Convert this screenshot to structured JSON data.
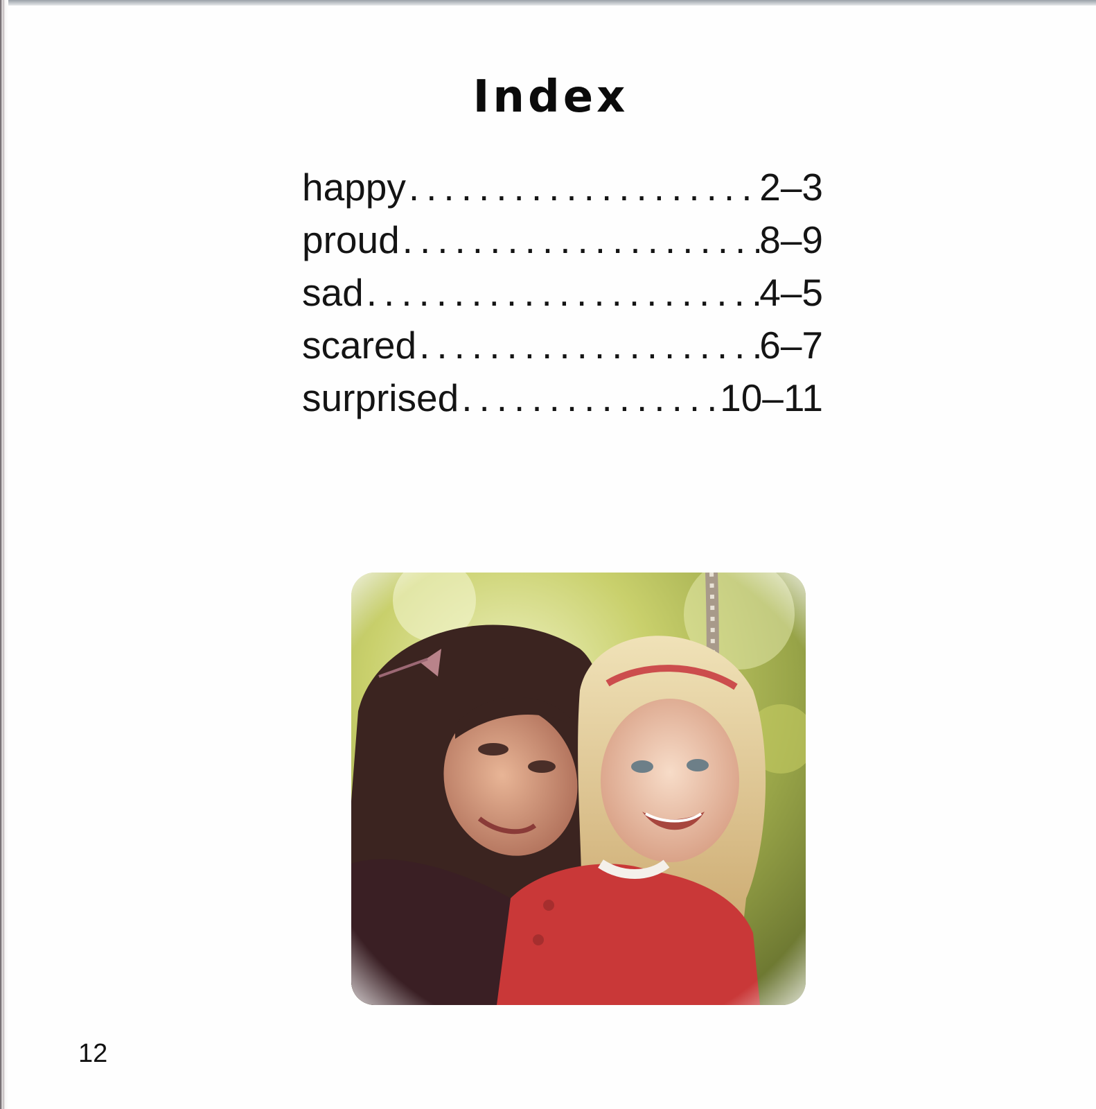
{
  "index": {
    "title": "Index",
    "entries": [
      {
        "term": "happy",
        "pages": "2–3"
      },
      {
        "term": "proud",
        "pages": "8–9"
      },
      {
        "term": "sad",
        "pages": "4–5"
      },
      {
        "term": "scared",
        "pages": "6–7"
      },
      {
        "term": "surprised",
        "pages": "10–11"
      }
    ],
    "leader": "........................................"
  },
  "photo": {
    "subject": "two girls on a rope swing"
  },
  "footer": {
    "page_number": "12"
  }
}
